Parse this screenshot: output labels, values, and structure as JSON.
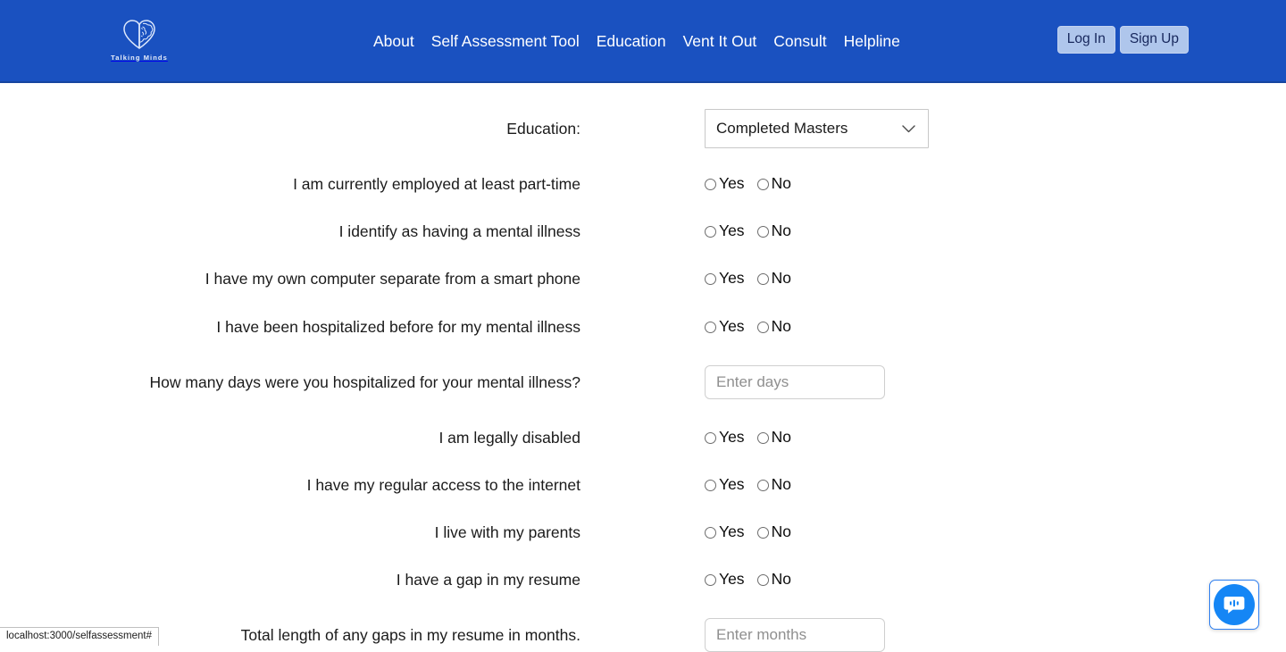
{
  "header": {
    "brand": {
      "name": "Talking Minds",
      "icon": "heart-brain-logo"
    },
    "nav_items": [
      {
        "label": "About"
      },
      {
        "label": "Self Assessment Tool"
      },
      {
        "label": "Education"
      },
      {
        "label": "Vent It Out"
      },
      {
        "label": "Consult"
      },
      {
        "label": "Helpline"
      }
    ],
    "auth": {
      "login_label": "Log In",
      "signup_label": "Sign Up"
    },
    "background_color": "#1A51C0",
    "auth_button_color": "#AFC6EC"
  },
  "form": {
    "education": {
      "label": "Education:",
      "selected": "Completed Masters",
      "chevron_icon": "chevron-down-icon"
    },
    "radio_options": {
      "yes": "Yes",
      "no": "No"
    },
    "rows": [
      {
        "type": "radio",
        "label": "I am currently employed at least part-time",
        "selected": null
      },
      {
        "type": "radio",
        "label": "I identify as having a mental illness",
        "selected": null
      },
      {
        "type": "radio",
        "label": "I have my own computer separate from a smart phone",
        "selected": null
      },
      {
        "type": "radio",
        "label": "I have been hospitalized before for my mental illness",
        "selected": null
      },
      {
        "type": "input",
        "label": "How many days were you hospitalized for your mental illness?",
        "placeholder": "Enter days",
        "value": ""
      },
      {
        "type": "radio",
        "label": "I am legally disabled",
        "selected": null
      },
      {
        "type": "radio",
        "label": "I have my regular access to the internet",
        "selected": null
      },
      {
        "type": "radio",
        "label": "I live with my parents",
        "selected": null
      },
      {
        "type": "radio",
        "label": "I have a gap in my resume",
        "selected": null
      },
      {
        "type": "input",
        "label": "Total length of any gaps in my resume in months.",
        "placeholder": "Enter months",
        "value": ""
      }
    ]
  },
  "chat_widget": {
    "icon": "chat-bubble-icon",
    "color": "#1586f5"
  },
  "status_bar": {
    "link_preview": "localhost:3000/selfassessment#"
  }
}
